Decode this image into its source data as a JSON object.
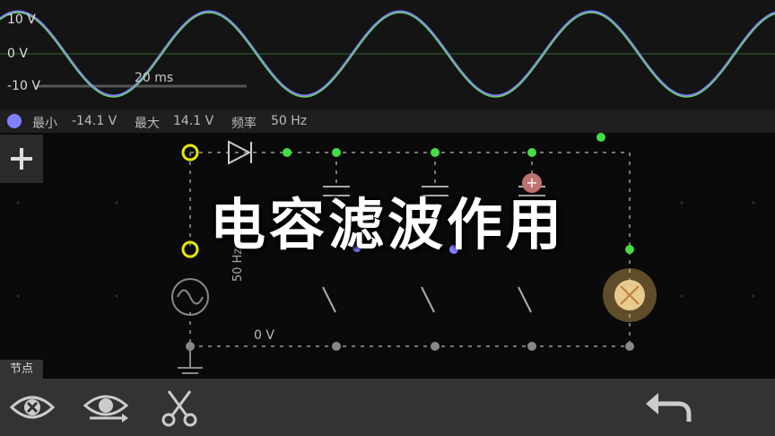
{
  "scope": {
    "volt_labels": [
      "10 V",
      "0 V",
      "-10 V"
    ],
    "timebase": "20 ms",
    "trace_color": "#8080ff",
    "trace2_color": "#66cc66"
  },
  "info": {
    "min_label": "最小",
    "min_value": "-14.1 V",
    "max_label": "最大",
    "max_value": "14.1 V",
    "freq_label": "频率",
    "freq_value": "50 Hz"
  },
  "circuit": {
    "source_freq": "50 Hz",
    "ground_label": "0 V"
  },
  "overlay_title": "电容滤波作用",
  "node_tab": "节点",
  "toolbar": {
    "add_icon": "plus-icon",
    "hide_icon": "eye-close-icon",
    "view_icon": "eye-cycle-icon",
    "cut_icon": "scissors-icon",
    "undo_icon": "undo-arrow-icon"
  }
}
